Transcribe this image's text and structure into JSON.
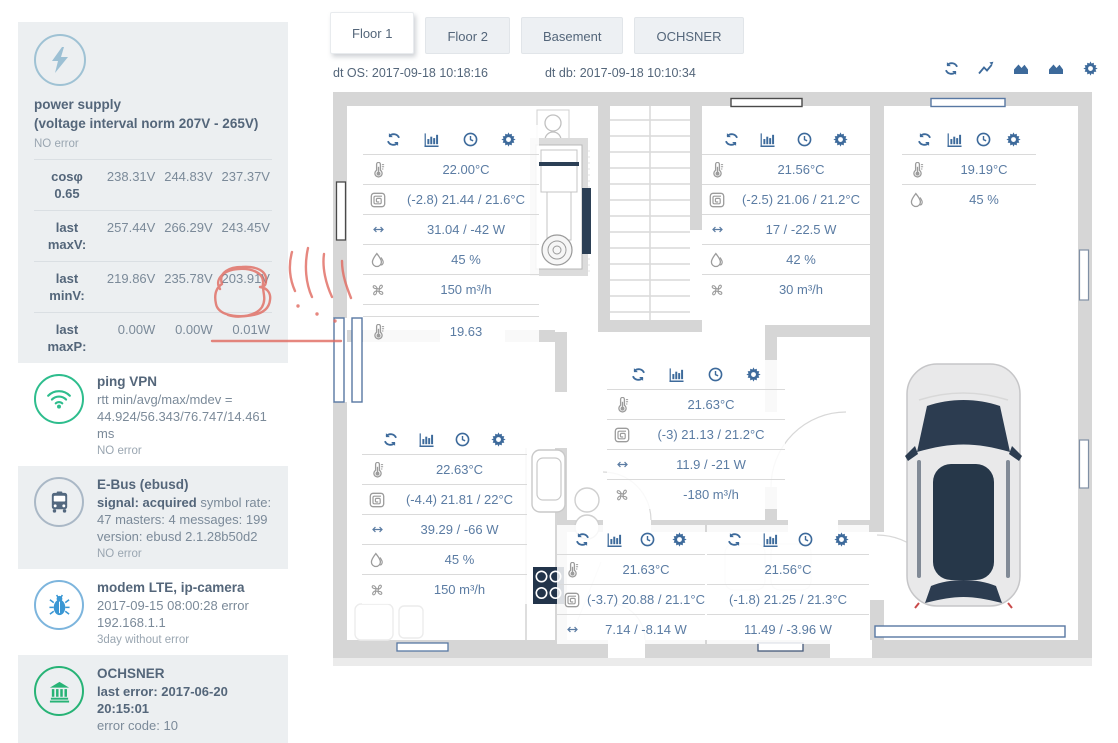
{
  "sidebar": {
    "power": {
      "title_line1": "power supply",
      "title_line2": "(voltage interval norm 207V - 265V)",
      "status": "NO error",
      "rows": [
        {
          "label1": "cosφ",
          "label2": "0.65",
          "v1": "238.31V",
          "v2": "244.83V",
          "v3": "237.37V"
        },
        {
          "label1": "last",
          "label2": "maxV:",
          "v1": "257.44V",
          "v2": "266.29V",
          "v3": "243.45V"
        },
        {
          "label1": "last",
          "label2": "minV:",
          "v1": "219.86V",
          "v2": "235.78V",
          "v3": "203.91V"
        },
        {
          "label1": "last",
          "label2": "maxP:",
          "v1": "0.00W",
          "v2": "0.00W",
          "v3": "0.01W"
        }
      ]
    },
    "ping": {
      "title": "ping VPN",
      "line1": "rtt min/avg/max/mdev =",
      "line2": "44.924/56.343/76.747/14.461 ms",
      "status": "NO error"
    },
    "ebus": {
      "title": "E-Bus (ebusd)",
      "signal_bold": "signal: acquired",
      "signal_rest": " symbol rate: 47 masters: 4 messages: 199 version: ebusd 2.1.28b50d2",
      "status": "NO error"
    },
    "modem": {
      "title": "modem LTE, ip-camera",
      "line1": "2017-09-15 08:00:28 error",
      "line2": "192.168.1.1",
      "status": "3day without error"
    },
    "ochsner": {
      "title": "OCHSNER",
      "line1": "last error: 2017-06-20 20:15:01",
      "line2": "error code: 10"
    }
  },
  "tabs": [
    {
      "label": "Floor 1",
      "active": true
    },
    {
      "label": "Floor 2",
      "active": false
    },
    {
      "label": "Basement",
      "active": false
    },
    {
      "label": "OCHSNER",
      "active": false
    }
  ],
  "meta": {
    "dt_os": "dt OS: 2017-09-18 10:18:16",
    "dt_db": "dt db: 2017-09-18 10:10:34"
  },
  "toolbar": {
    "icons": [
      "refresh",
      "linechart",
      "areachart",
      "areachart",
      "gear"
    ]
  },
  "panel_header_icons": [
    "refresh",
    "chart",
    "clock",
    "gear"
  ],
  "panels": [
    {
      "id": "a",
      "rows": [
        {
          "icon": "thermometer",
          "value": "22.00°C"
        },
        {
          "icon": "coil",
          "value": "(-2.8) 21.44 / 21.6°C"
        },
        {
          "icon": "arrows",
          "value": "31.04 / -42 W"
        },
        {
          "icon": "drop",
          "value": "45 %"
        },
        {
          "icon": "fan",
          "value": "150 m³/h"
        },
        {
          "icon": "spacer",
          "value": ""
        },
        {
          "icon": "thermometer",
          "value": "19.63"
        }
      ]
    },
    {
      "id": "b",
      "rows": [
        {
          "icon": "thermometer",
          "value": "21.56°C"
        },
        {
          "icon": "coil",
          "value": "(-2.5) 21.06 / 21.2°C"
        },
        {
          "icon": "arrows",
          "value": "17 / -22.5 W"
        },
        {
          "icon": "drop",
          "value": "42 %"
        },
        {
          "icon": "fan",
          "value": "30 m³/h"
        }
      ]
    },
    {
      "id": "c",
      "rows": [
        {
          "icon": "thermometer",
          "value": "19.19°C"
        },
        {
          "icon": "drop",
          "value": "45 %"
        }
      ]
    },
    {
      "id": "d",
      "rows": [
        {
          "icon": "thermometer",
          "value": "21.63°C"
        },
        {
          "icon": "coil",
          "value": "(-3) 21.13 / 21.2°C"
        },
        {
          "icon": "arrows",
          "value": "11.9 / -21 W"
        },
        {
          "icon": "fan",
          "value": "-180 m³/h"
        }
      ]
    },
    {
      "id": "e",
      "rows": [
        {
          "icon": "thermometer",
          "value": "22.63°C"
        },
        {
          "icon": "coil",
          "value": "(-4.4) 21.81 / 22°C"
        },
        {
          "icon": "arrows",
          "value": "39.29 / -66 W"
        },
        {
          "icon": "drop",
          "value": "45 %"
        },
        {
          "icon": "fan",
          "value": "150 m³/h"
        }
      ]
    },
    {
      "id": "f",
      "rows": [
        {
          "icon": "thermometer",
          "value": "21.63°C"
        },
        {
          "icon": "coil",
          "value": "(-3.7) 20.88 / 21.1°C"
        },
        {
          "icon": "arrows",
          "value": "7.14 / -8.14 W"
        }
      ]
    },
    {
      "id": "g",
      "rows": [
        {
          "icon": "",
          "value": "21.56°C"
        },
        {
          "icon": "",
          "value": "(-1.8) 21.25 / 21.3°C"
        },
        {
          "icon": "",
          "value": "11.49 / -3.96 W"
        }
      ]
    }
  ],
  "annotation": {
    "highlighted_value": "0.01W",
    "color": "#e06a60"
  },
  "colors": {
    "accent_blue": "#3d6a9b",
    "value_text": "#5b7ca3",
    "wifi_green": "#2ebd8d",
    "bank_green": "#27b376",
    "bug_blue": "#3a97d4",
    "bus_gray": "#53687f",
    "power_light_blue": "#9cc0d4",
    "panel_bg_gray": "#eceff1",
    "annotation_red": "#e06a60"
  }
}
